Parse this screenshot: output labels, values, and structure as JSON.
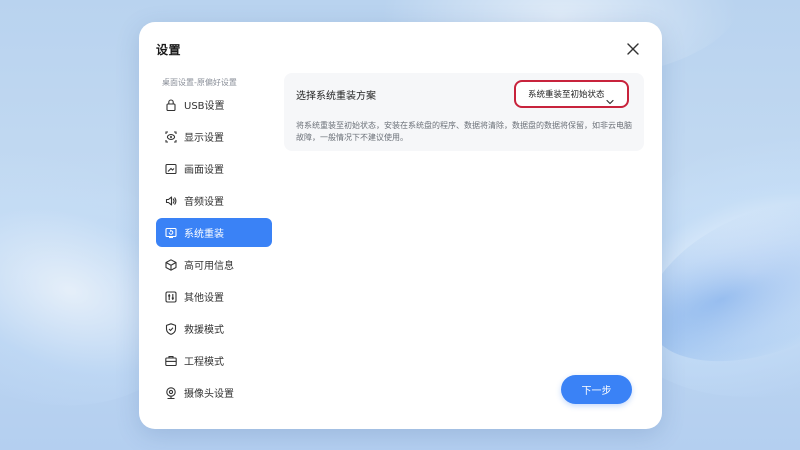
{
  "dialog": {
    "title": "设置",
    "close_icon": "close-icon"
  },
  "sidebar": {
    "caption": "桌面设置-原偏好设置",
    "items": [
      {
        "label": "USB设置",
        "icon": "lock-icon",
        "active": false
      },
      {
        "label": "显示设置",
        "icon": "display-eye-icon",
        "active": false
      },
      {
        "label": "画面设置",
        "icon": "picture-icon",
        "active": false
      },
      {
        "label": "音频设置",
        "icon": "speaker-icon",
        "active": false
      },
      {
        "label": "系统重装",
        "icon": "system-reinstall-icon",
        "active": true
      },
      {
        "label": "高可用信息",
        "icon": "cube-icon",
        "active": false
      },
      {
        "label": "其他设置",
        "icon": "sliders-icon",
        "active": false
      },
      {
        "label": "救援模式",
        "icon": "shield-icon",
        "active": false
      },
      {
        "label": "工程模式",
        "icon": "toolbox-icon",
        "active": false
      },
      {
        "label": "摄像头设置",
        "icon": "camera-icon",
        "active": false
      }
    ]
  },
  "main": {
    "option_label": "选择系统重装方案",
    "select": {
      "value": "系统重装至初始状态",
      "icon": "chevron-down-icon"
    },
    "description": "将系统重装至初始状态，安装在系统盘的程序、数据将清除，数据盘的数据将保留，如非云电脑故障，一般情况下不建议使用。"
  },
  "footer": {
    "next_label": "下一步"
  },
  "colors": {
    "accent": "#3a82f6",
    "highlight_border": "#c8233c",
    "panel_bg": "#f6f7f9"
  }
}
